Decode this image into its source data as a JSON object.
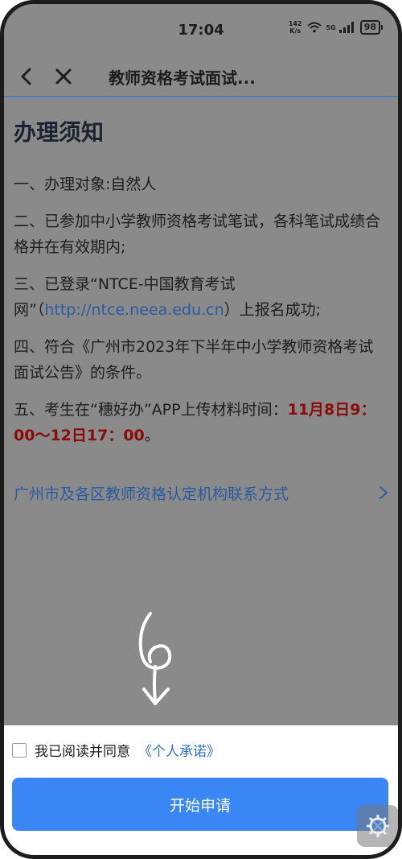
{
  "status_bar": {
    "time": "17:04",
    "net_speed_value": "142",
    "net_speed_unit": "K/s",
    "signal_label": "5G",
    "battery": "98"
  },
  "nav": {
    "title": "教师资格考试面试..."
  },
  "page": {
    "title": "办理须知",
    "items": [
      {
        "text": "一、办理对象:自然人"
      },
      {
        "text": "二、已参加中小学教师资格考试笔试，各科笔试成绩合格并在有效期内;"
      },
      {
        "prefix": "三、已登录“NTCE-中国教育考试网”（",
        "link": "http://ntce.neea.edu.cn",
        "suffix": "）上报名成功;"
      },
      {
        "text": "四、符合《广州市2023年下半年中小学教师资格考试面试公告》的条件。"
      },
      {
        "prefix": "五、考生在“穗好办”APP上传材料时间：",
        "highlight": "11月8日9：00～12日17：00",
        "suffix": "。"
      }
    ],
    "contact_link": "广州市及各区教师资格认定机构联系方式"
  },
  "annotation": {
    "handwritten_digit": "6"
  },
  "footer": {
    "agree_text": "我已阅读并同意",
    "agree_link": "《个人承诺》",
    "start_button": "开始申请"
  },
  "icons": {
    "back": "chevron-left-icon",
    "close": "close-icon",
    "forward": "chevron-right-icon",
    "wifi": "wifi-icon",
    "signal": "signal-bars-icon",
    "floating": "gear-icon"
  },
  "colors": {
    "overlay_gray": "#8a8a8a",
    "link_blue": "#2a5aa0",
    "highlight_red": "#8b0a0a",
    "button_blue": "#3a86f5"
  }
}
